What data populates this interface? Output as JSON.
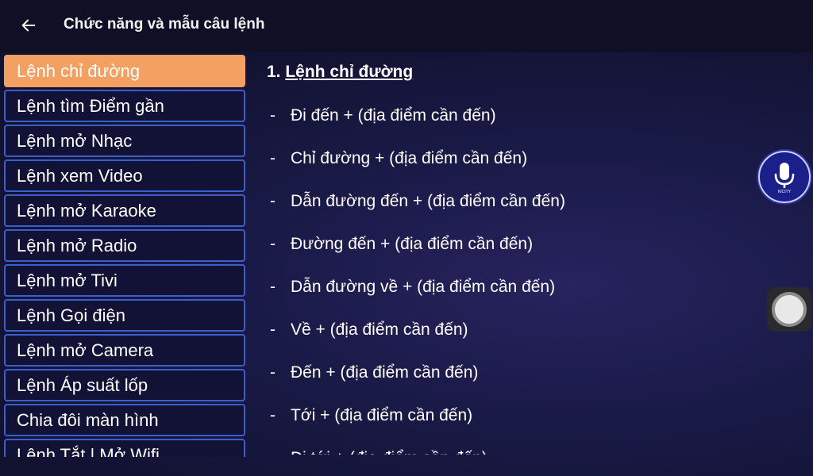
{
  "header": {
    "title": "Chức năng và mẫu câu lệnh",
    "back_icon": "arrow-left-icon"
  },
  "colors": {
    "background": "#101127",
    "active_item": "#f4a062",
    "item_border": "#3b5ec8",
    "mic_button": "#1b1f8a"
  },
  "sidebar": {
    "items": [
      {
        "label": "Lệnh chỉ đường",
        "active": true
      },
      {
        "label": "Lệnh tìm Điểm gần"
      },
      {
        "label": "Lệnh mở Nhạc"
      },
      {
        "label": "Lệnh xem Video"
      },
      {
        "label": "Lệnh mở Karaoke"
      },
      {
        "label": "Lệnh mở Radio"
      },
      {
        "label": "Lệnh mở Tivi"
      },
      {
        "label": "Lệnh Gọi điện"
      },
      {
        "label": "Lệnh mở Camera"
      },
      {
        "label": "Lệnh Áp suất lốp"
      },
      {
        "label": "Chia đôi màn hình"
      },
      {
        "label": "Lệnh Tắt | Mở Wifi"
      }
    ]
  },
  "main": {
    "section_number": "1.",
    "section_title": "Lệnh chỉ đường",
    "commands": [
      "Đi đến + (địa điểm cần đến)",
      "Chỉ đường + (địa điểm cần đến)",
      "Dẫn đường đến + (địa điểm cần đến)",
      "Đường đến + (địa điểm cần đến)",
      "Dẫn đường về + (địa điểm cần đến)",
      "Về + (địa điểm cần đến)",
      "Đến + (địa điểm cần đến)",
      "Tới + (địa điểm cần đến)",
      "Đi tới + (địa điểm cần đến)"
    ],
    "dash": "-"
  },
  "floating": {
    "mic_icon": "microphone-icon",
    "mic_caption": "KICITY",
    "assist_icon": "assistive-touch-icon"
  }
}
